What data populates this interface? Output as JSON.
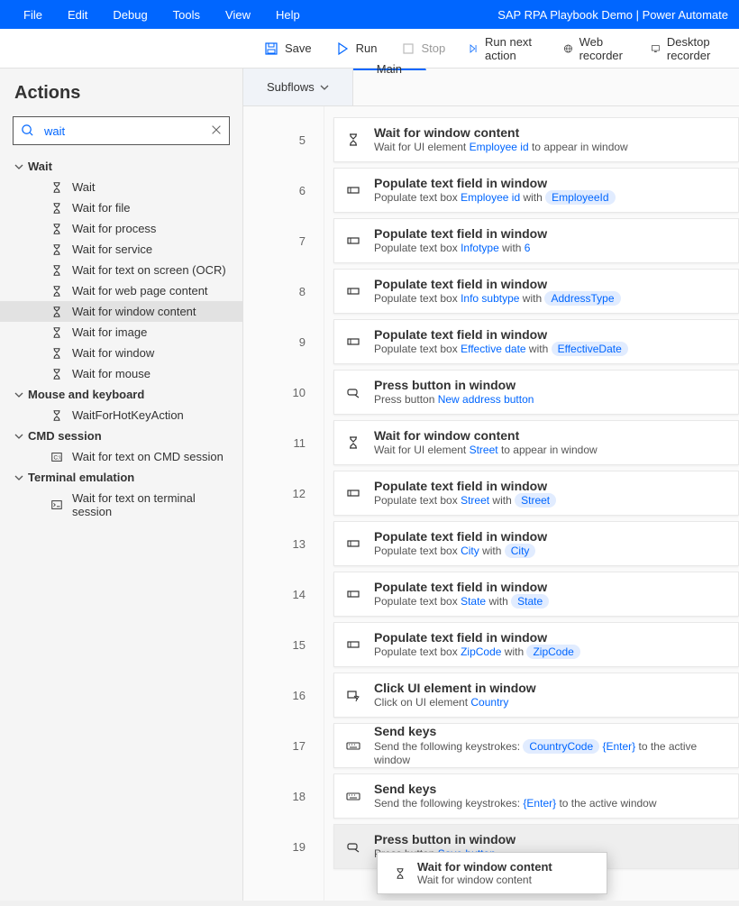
{
  "app_title": "SAP RPA Playbook Demo | Power Automate",
  "menus": [
    "File",
    "Edit",
    "Debug",
    "Tools",
    "View",
    "Help"
  ],
  "toolbar": {
    "save": "Save",
    "run": "Run",
    "stop": "Stop",
    "run_next": "Run next action",
    "web_rec": "Web recorder",
    "desk_rec": "Desktop recorder"
  },
  "sidebar": {
    "title": "Actions",
    "search_value": "wait",
    "groups": [
      {
        "label": "Wait",
        "items": [
          {
            "icon": "hourglass",
            "label": "Wait"
          },
          {
            "icon": "hourglass",
            "label": "Wait for file"
          },
          {
            "icon": "hourglass",
            "label": "Wait for process"
          },
          {
            "icon": "hourglass",
            "label": "Wait for service"
          },
          {
            "icon": "hourglass",
            "label": "Wait for text on screen (OCR)"
          },
          {
            "icon": "hourglass",
            "label": "Wait for web page content"
          },
          {
            "icon": "hourglass",
            "label": "Wait for window content",
            "selected": true
          },
          {
            "icon": "hourglass",
            "label": "Wait for image"
          },
          {
            "icon": "hourglass",
            "label": "Wait for window"
          },
          {
            "icon": "hourglass",
            "label": "Wait for mouse"
          }
        ]
      },
      {
        "label": "Mouse and keyboard",
        "items": [
          {
            "icon": "hourglass",
            "label": "WaitForHotKeyAction"
          }
        ]
      },
      {
        "label": "CMD session",
        "items": [
          {
            "icon": "cmd",
            "label": "Wait for text on CMD session"
          }
        ]
      },
      {
        "label": "Terminal emulation",
        "items": [
          {
            "icon": "terminal",
            "label": "Wait for text on terminal session"
          }
        ]
      }
    ]
  },
  "tabs": {
    "subflows": "Subflows",
    "main": "Main"
  },
  "steps": [
    {
      "n": 5,
      "icon": "hourglass",
      "title": "Wait for window content",
      "sub": [
        {
          "t": "Wait for UI element "
        },
        {
          "lk": "Employee id"
        },
        {
          "t": " to appear in window"
        }
      ]
    },
    {
      "n": 6,
      "icon": "field",
      "title": "Populate text field in window",
      "sub": [
        {
          "t": "Populate text box "
        },
        {
          "lk": "Employee id"
        },
        {
          "t": " with "
        },
        {
          "chip": "EmployeeId"
        }
      ]
    },
    {
      "n": 7,
      "icon": "field",
      "title": "Populate text field in window",
      "sub": [
        {
          "t": "Populate text box "
        },
        {
          "lk": "Infotype"
        },
        {
          "t": " with "
        },
        {
          "lk": "6"
        }
      ]
    },
    {
      "n": 8,
      "icon": "field",
      "title": "Populate text field in window",
      "sub": [
        {
          "t": "Populate text box "
        },
        {
          "lk": "Info subtype"
        },
        {
          "t": " with "
        },
        {
          "chip": "AddressType"
        }
      ]
    },
    {
      "n": 9,
      "icon": "field",
      "title": "Populate text field in window",
      "sub": [
        {
          "t": "Populate text box "
        },
        {
          "lk": "Effective date"
        },
        {
          "t": " with "
        },
        {
          "chip": "EffectiveDate"
        }
      ]
    },
    {
      "n": 10,
      "icon": "press",
      "title": "Press button in window",
      "sub": [
        {
          "t": "Press button "
        },
        {
          "lk": "New address button"
        }
      ]
    },
    {
      "n": 11,
      "icon": "hourglass",
      "title": "Wait for window content",
      "sub": [
        {
          "t": "Wait for UI element "
        },
        {
          "lk": "Street"
        },
        {
          "t": " to appear in window"
        }
      ]
    },
    {
      "n": 12,
      "icon": "field",
      "title": "Populate text field in window",
      "sub": [
        {
          "t": "Populate text box "
        },
        {
          "lk": "Street"
        },
        {
          "t": " with "
        },
        {
          "chip": "Street"
        }
      ]
    },
    {
      "n": 13,
      "icon": "field",
      "title": "Populate text field in window",
      "sub": [
        {
          "t": "Populate text box "
        },
        {
          "lk": "City"
        },
        {
          "t": " with "
        },
        {
          "chip": "City"
        }
      ]
    },
    {
      "n": 14,
      "icon": "field",
      "title": "Populate text field in window",
      "sub": [
        {
          "t": "Populate text box "
        },
        {
          "lk": "State"
        },
        {
          "t": " with "
        },
        {
          "chip": "State"
        }
      ]
    },
    {
      "n": 15,
      "icon": "field",
      "title": "Populate text field in window",
      "sub": [
        {
          "t": "Populate text box "
        },
        {
          "lk": "ZipCode"
        },
        {
          "t": " with "
        },
        {
          "chip": "ZipCode"
        }
      ]
    },
    {
      "n": 16,
      "icon": "click",
      "title": "Click UI element in window",
      "sub": [
        {
          "t": "Click on UI element "
        },
        {
          "lk": "Country"
        }
      ]
    },
    {
      "n": 17,
      "icon": "keys",
      "title": "Send keys",
      "sub": [
        {
          "t": "Send the following keystrokes: "
        },
        {
          "chip": "CountryCode"
        },
        {
          "t": " "
        },
        {
          "lk": "{Enter}"
        },
        {
          "t": " to the active window"
        }
      ]
    },
    {
      "n": 18,
      "icon": "keys",
      "title": "Send keys",
      "sub": [
        {
          "t": "Send the following keystrokes: "
        },
        {
          "lk": "{Enter}"
        },
        {
          "t": " to the active window"
        }
      ]
    },
    {
      "n": 19,
      "icon": "press",
      "title": "Press button in window",
      "sub": [
        {
          "t": "Press button "
        },
        {
          "lk": "Save button"
        }
      ],
      "sel": true
    }
  ],
  "tooltip": {
    "title": "Wait for window content",
    "sub": "Wait for window content"
  }
}
